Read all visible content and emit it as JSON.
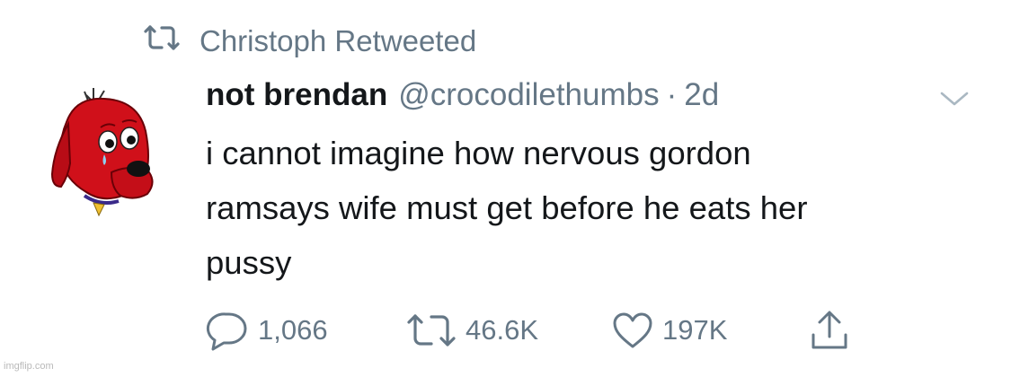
{
  "retweet_header": {
    "text": "Christoph Retweeted",
    "icon": "retweet-icon"
  },
  "tweet": {
    "display_name": "not brendan",
    "handle": "@crocodilethumbs",
    "separator": "·",
    "time": "2d",
    "text_lines": [
      "i cannot imagine how nervous gordon",
      "ramsays wife must get before he eats her",
      "pussy"
    ],
    "avatar": "cartoon-red-dog-avatar"
  },
  "actions": {
    "reply": {
      "icon": "reply-icon",
      "count": "1,066"
    },
    "retweet": {
      "icon": "retweet-icon",
      "count": "46.6K"
    },
    "like": {
      "icon": "heart-icon",
      "count": "197K"
    },
    "share": {
      "icon": "share-icon"
    }
  },
  "watermark": "imgflip.com",
  "colors": {
    "text": "#14171a",
    "secondary": "#657786",
    "avatar_red": "#d0101a"
  }
}
